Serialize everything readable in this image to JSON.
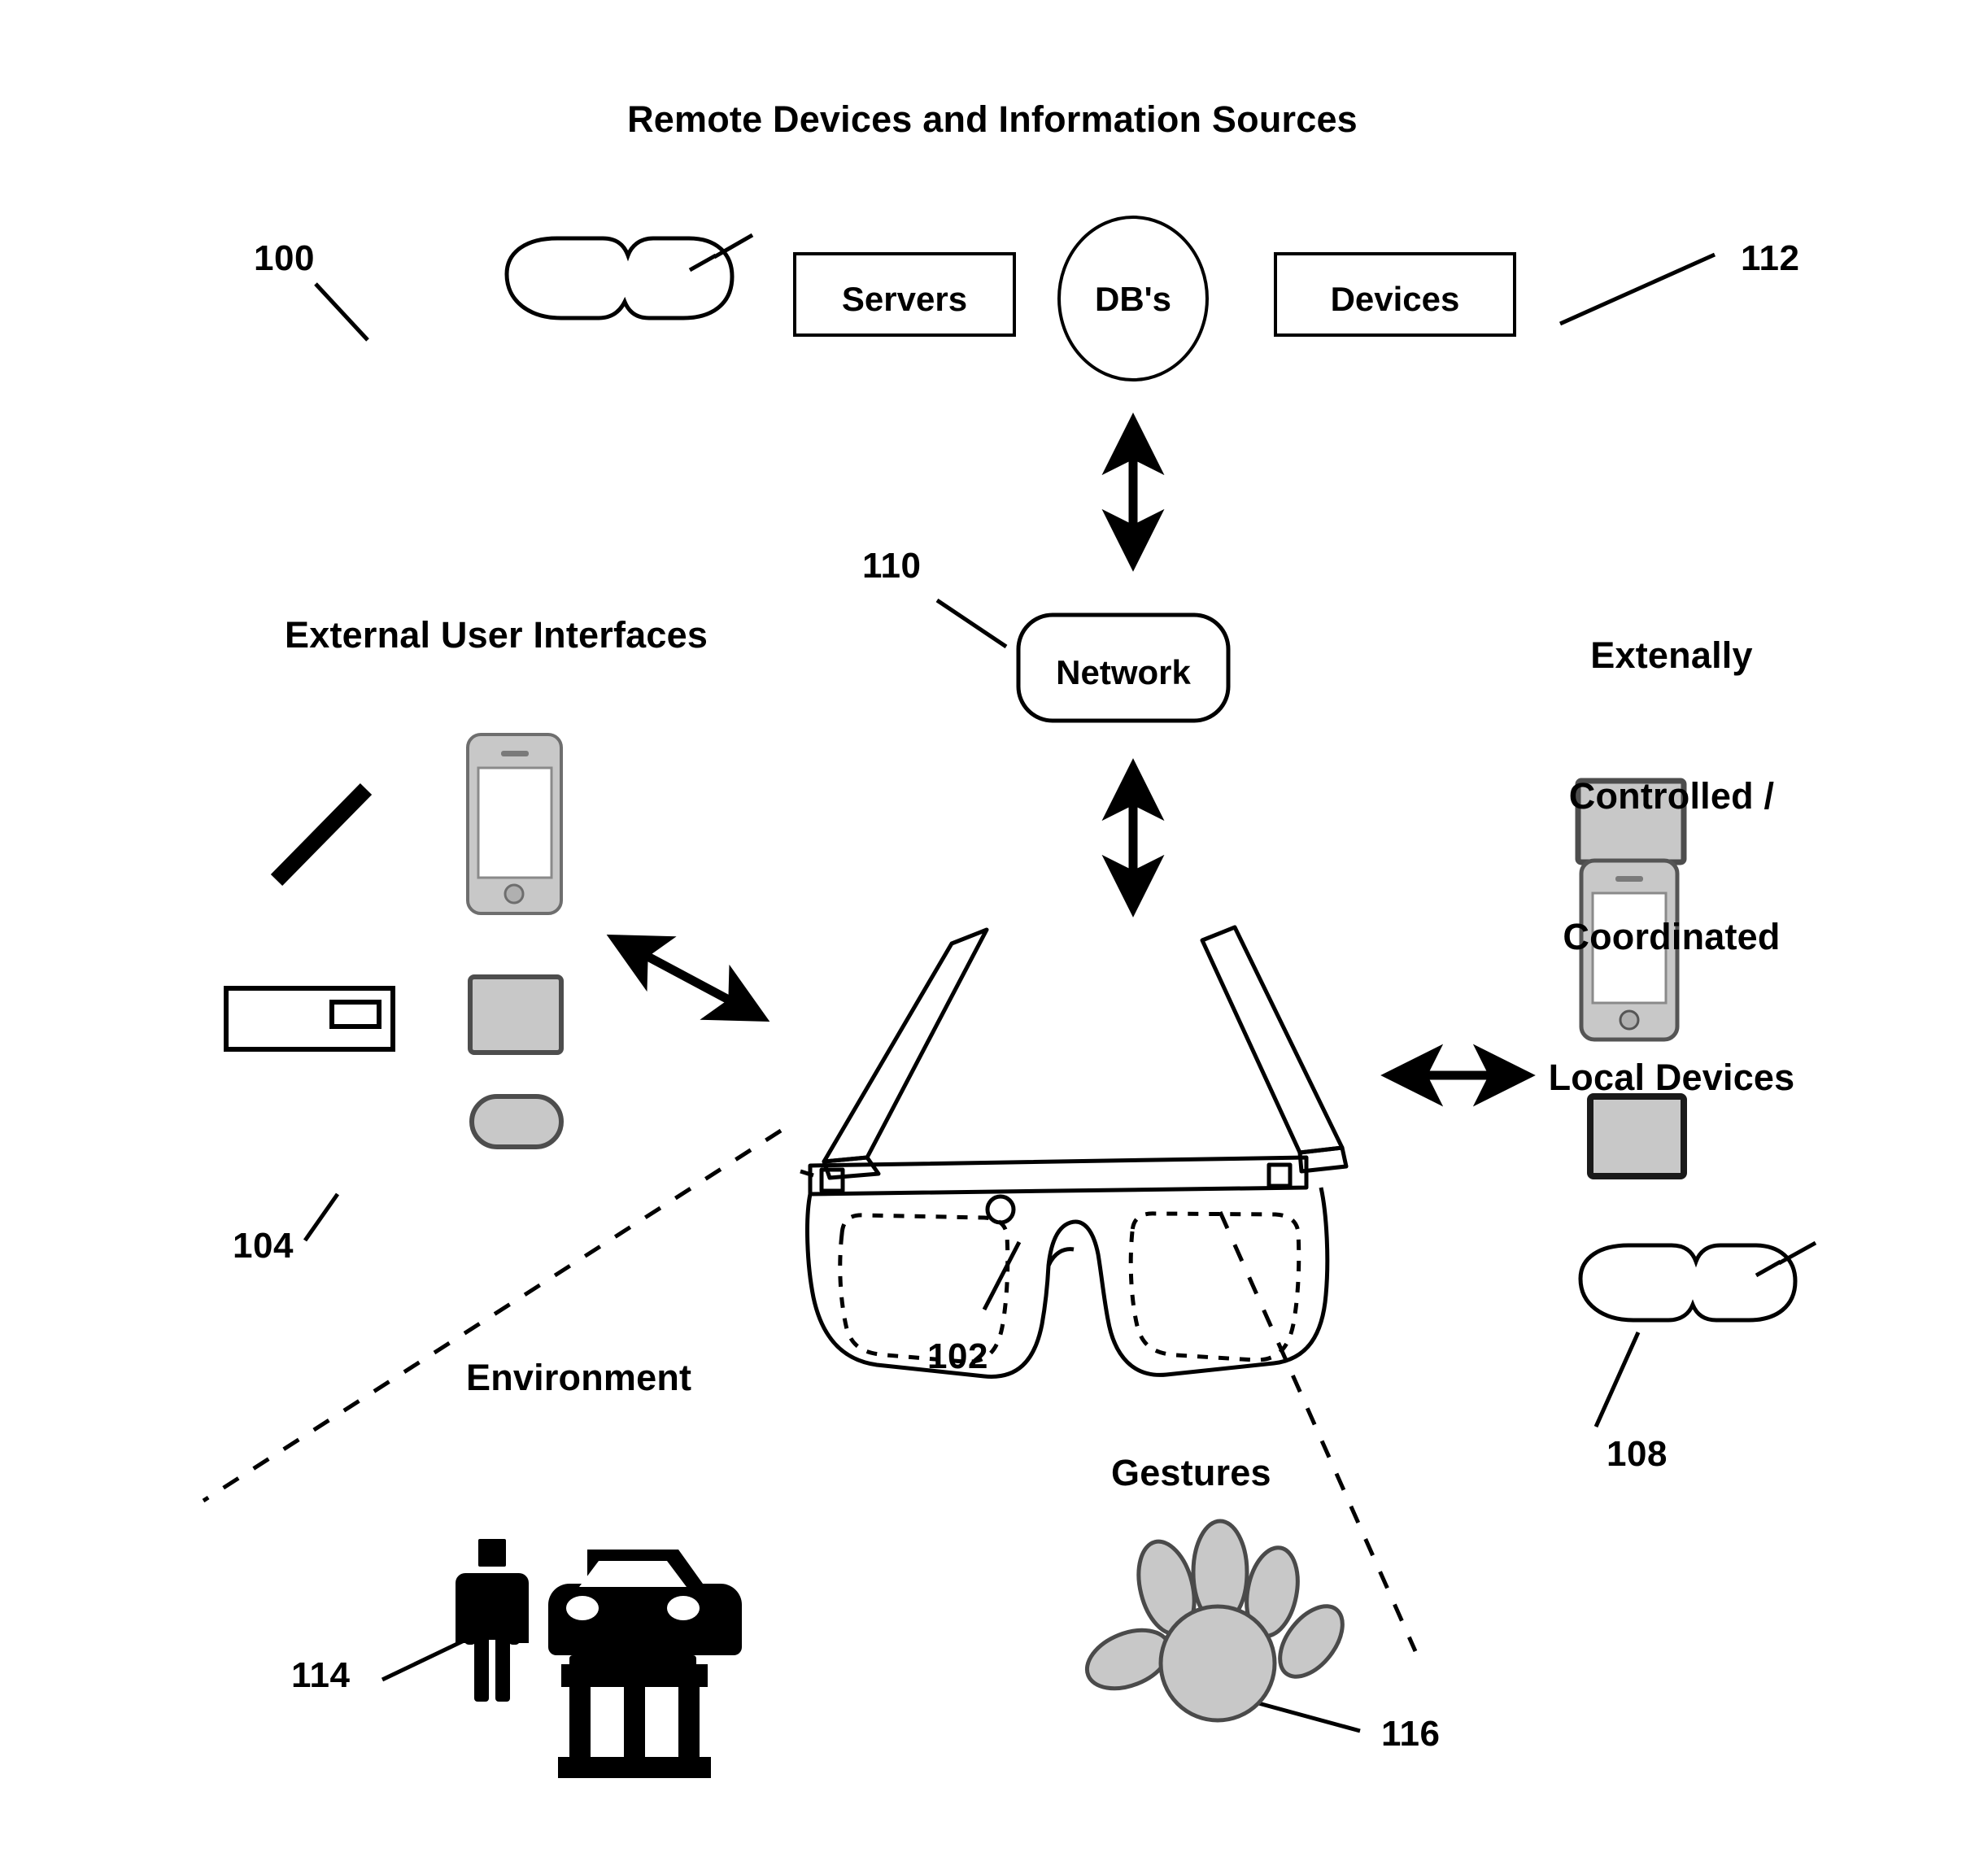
{
  "figure": {
    "title": "Remote Devices and Information Sources",
    "section_labels": {
      "external_user_interfaces": "External User Interfaces",
      "externally_controlled": "Extenally\nControlled /\nCoordinated\nLocal Devices",
      "externally_controlled_lines": [
        "Extenally",
        "Controlled /",
        "Coordinated",
        "Local Devices"
      ],
      "environment": "Environment",
      "gestures": "Gestures"
    },
    "nodes": {
      "servers": "Servers",
      "databases": "DB's",
      "devices": "Devices",
      "network": "Network"
    },
    "reference_numerals": {
      "system": "100",
      "eyewear": "102",
      "external_user_interfaces": "104",
      "local_devices": "108",
      "network": "110",
      "remote_sources": "112",
      "environment": "114",
      "gestures": "116"
    },
    "icons": {
      "goggles_top": "goggles-icon",
      "goggles_right": "goggles-icon",
      "stylus": "stylus-icon",
      "remote_control": "remote-control-icon",
      "phone_left": "smartphone-icon",
      "tablet_left": "tablet-icon",
      "pill_left": "wearable-puck-icon",
      "tablet_right_top": "tablet-icon",
      "phone_right": "smartphone-icon",
      "tablet_right_bottom": "tablet-icon",
      "person": "person-icon",
      "car": "car-icon",
      "building": "bank-building-icon",
      "hand": "hand-gesture-icon",
      "eyewear": "smart-glasses-icon"
    },
    "colors": {
      "ink": "#000000",
      "device_fill": "#c8c8c8",
      "paper": "#ffffff"
    }
  }
}
